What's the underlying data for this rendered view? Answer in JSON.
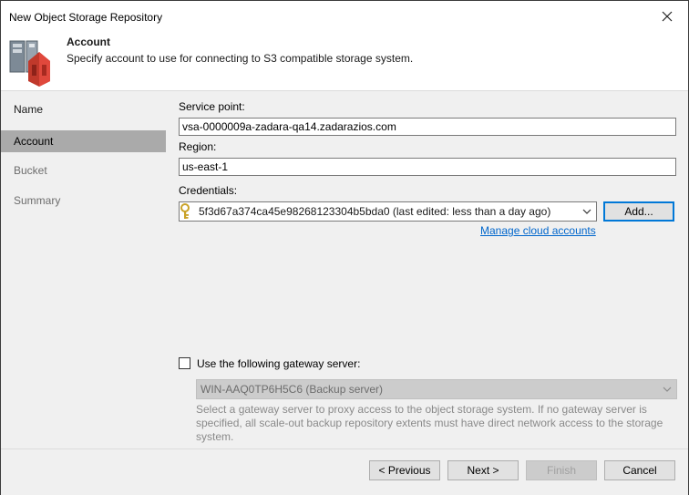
{
  "window": {
    "title": "New Object Storage Repository"
  },
  "header": {
    "title": "Account",
    "subtitle": "Specify account to use for connecting to S3 compatible storage system."
  },
  "sidebar": {
    "items": [
      {
        "label": "Name",
        "state": "normal"
      },
      {
        "label": "Account",
        "state": "active"
      },
      {
        "label": "Bucket",
        "state": "disabled"
      },
      {
        "label": "Summary",
        "state": "disabled"
      }
    ]
  },
  "form": {
    "service_point_label": "Service point:",
    "service_point_value": "vsa-0000009a-zadara-qa14.zadarazios.com",
    "region_label": "Region:",
    "region_value": "us-east-1",
    "credentials_label": "Credentials:",
    "credentials_value": "5f3d67a374ca45e98268123304b5bda0 (last edited: less than a day ago)",
    "add_button": "Add...",
    "manage_link": "Manage cloud accounts",
    "gateway_checkbox_label": "Use the following gateway server:",
    "gateway_checked": false,
    "gateway_server_value": "WIN-AAQ0TP6H5C6 (Backup server)",
    "gateway_hint": "Select a gateway server to proxy access to the object storage system. If no gateway server is specified, all scale-out backup repository extents must have direct network access to the storage system."
  },
  "footer": {
    "previous": "< Previous",
    "next": "Next >",
    "finish": "Finish",
    "cancel": "Cancel"
  },
  "colors": {
    "accent": "#0078d7",
    "link": "#0066cc",
    "panel": "#f0f0f0",
    "active_item": "#aaaaaa",
    "icon_red": "#d9342b"
  },
  "icons": [
    "storage-repository-icon",
    "close-icon",
    "key-icon",
    "chevron-down-icon"
  ]
}
